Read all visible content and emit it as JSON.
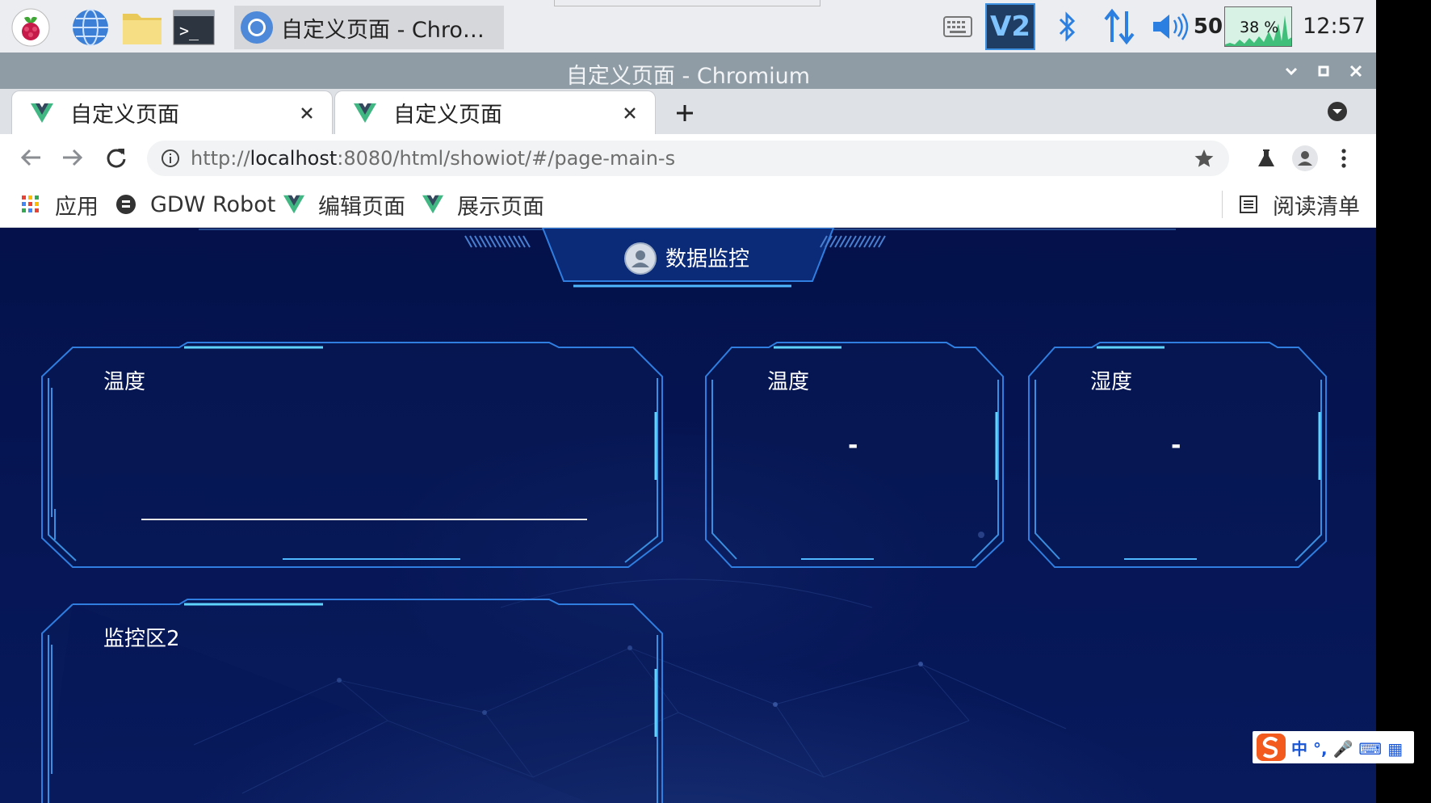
{
  "taskbar": {
    "window_title": "自定义页面 - Chromiu...",
    "volume_value": "50",
    "cpu_label": "38 %",
    "clock": "12:57"
  },
  "window": {
    "title": "自定义页面 - Chromium"
  },
  "tabs": [
    {
      "label": "自定义页面"
    },
    {
      "label": "自定义页面"
    }
  ],
  "toolbar": {
    "url_prefix": "http://",
    "url_host": "localhost",
    "url_rest": ":8080/html/showiot/#/page-main-s"
  },
  "bookmarks": {
    "apps": "应用",
    "gdw": "GDW Robot",
    "edit": "编辑页面",
    "show": "展示页面",
    "reading_list": "阅读清单"
  },
  "page": {
    "banner_title": "数据监控",
    "panels": [
      {
        "title": "温度"
      },
      {
        "title": "温度",
        "value": "-"
      },
      {
        "title": "湿度",
        "value": "-"
      },
      {
        "title": "监控区2"
      }
    ]
  },
  "ime": {
    "label": "中 °, 🎤 ⌨ ▦"
  },
  "colors": {
    "page_bg": "#04114a",
    "frame": "#3a8fe0",
    "frame_glow": "#5fd4ff",
    "titlebar": "#8f9ca5",
    "vue_green": "#41b883"
  }
}
